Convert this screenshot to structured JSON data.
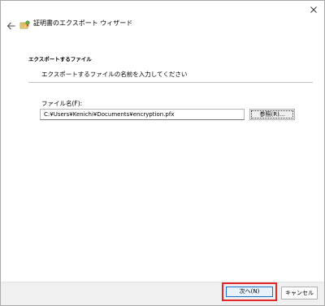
{
  "window": {
    "title": "証明書のエクスポート ウィザード",
    "close_icon": "close-icon",
    "back_icon": "back-arrow-icon",
    "wizard_icon": "certificate-wizard-icon"
  },
  "section": {
    "heading": "エクスポートするファイル",
    "subheading": "エクスポートするファイルの名前を入力してください"
  },
  "file_field": {
    "label": "ファイル名(F):",
    "value": "C:¥Users¥Kenichi¥Documents¥encryption.pfx"
  },
  "buttons": {
    "browse_label": "参照(R)...",
    "next_label": "次へ(N)",
    "cancel_label": "キャンセル"
  },
  "colors": {
    "highlight": "#e32626",
    "focus_blue": "#1a73c9",
    "footer_bg": "#f0f0f0"
  }
}
